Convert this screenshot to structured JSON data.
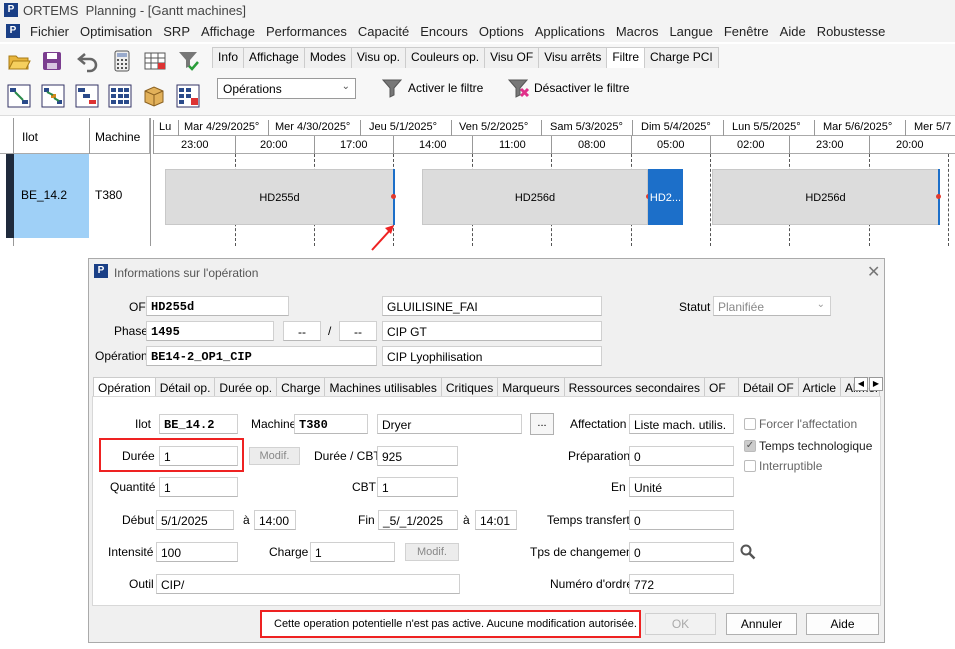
{
  "window": {
    "app_name": "ORTEMS",
    "title": "Planning - [Gantt machines]",
    "logo_letter": "P"
  },
  "menu": [
    "Fichier",
    "Optimisation",
    "SRP",
    "Affichage",
    "Performances",
    "Capacité",
    "Encours",
    "Options",
    "Applications",
    "Macros",
    "Langue",
    "Fenêtre",
    "Aide",
    "Robustesse"
  ],
  "ribbon": {
    "tabs": [
      "Info",
      "Affichage",
      "Modes",
      "Visu op.",
      "Couleurs op.",
      "Visu OF",
      "Visu arrêts",
      "Filtre",
      "Charge PCI"
    ],
    "active_tab": "Filtre",
    "filter_select": "Opérations",
    "activate_filter": "Activer le filtre",
    "deactivate_filter": "Désactiver le filtre"
  },
  "gantt": {
    "col_ilot": "Ilot",
    "col_machine": "Machine",
    "days": [
      "Lu",
      "Mar 4/29/2025°",
      "Mer 4/30/2025°",
      "Jeu 5/1/2025°",
      "Ven 5/2/2025°",
      "Sam 5/3/2025°",
      "Dim 5/4/2025°",
      "Lun 5/5/2025°",
      "Mar 5/6/2025°",
      "Mer 5/7"
    ],
    "times": [
      "23:00",
      "20:00",
      "17:00",
      "14:00",
      "11:00",
      "08:00",
      "05:00",
      "02:00",
      "23:00",
      "20:00"
    ],
    "row": {
      "ilot": "BE_14.2",
      "machine": "T380"
    },
    "bars": [
      "HD255d",
      "HD256d",
      "HD2...",
      "HD256d"
    ]
  },
  "dialog": {
    "title": "Informations sur l'opération",
    "of_label": "OF",
    "of_value": "HD255d",
    "of_desc": "GLUILISINE_FAI",
    "phase_label": "Phase",
    "phase_value": "1495",
    "phase_a": "--",
    "phase_sep": "/",
    "phase_b": "--",
    "phase_desc": "CIP GT",
    "operation_label": "Opération",
    "operation_value": "BE14-2_OP1_CIP",
    "operation_desc": "CIP Lyophilisation",
    "statut_label": "Statut",
    "statut_value": "Planifiée",
    "tabs": [
      "Opération",
      "Détail op.",
      "Durée op.",
      "Charge",
      "Machines utilisables",
      "Critiques",
      "Marqueurs",
      "Ressources secondaires",
      "OF",
      "Détail OF",
      "Article",
      "Alimenta"
    ],
    "active_tab": "Opération",
    "fields": {
      "ilot_label": "Ilot",
      "ilot_value": "BE_14.2",
      "machine_label": "Machine",
      "machine_value": "T380",
      "machine_desc": "Dryer",
      "machine_btn": "...",
      "affectation_label": "Affectation",
      "affectation_value": "Liste mach. utilis.",
      "duree_label": "Durée",
      "duree_value": "1",
      "modif_label": "Modif.",
      "duree_cbt_label": "Durée / CBT",
      "duree_cbt_value": "925",
      "preparation_label": "Préparation",
      "preparation_value": "0",
      "quantite_label": "Quantité",
      "quantite_value": "1",
      "cbt_label": "CBT",
      "cbt_value": "1",
      "en_label": "En",
      "en_value": "Unité",
      "debut_label": "Début",
      "debut_date": "5/1/2025",
      "a_label": "à",
      "debut_time": "14:00",
      "fin_label": "Fin",
      "fin_date": "_5/_1/2025",
      "fin_time": "14:01",
      "temps_transfert_label": "Temps transfert",
      "temps_transfert_value": "0",
      "intensite_label": "Intensité",
      "intensite_value": "100",
      "charge_label": "Charge",
      "charge_value": "1",
      "charge_modif": "Modif.",
      "tps_changement_label": "Tps de changement",
      "tps_changement_value": "0",
      "outil_label": "Outil",
      "outil_value": "CIP/",
      "numero_ordre_label": "Numéro d'ordre",
      "numero_ordre_value": "772"
    },
    "checkboxes": [
      {
        "label": "Forcer l'affectation",
        "checked": false
      },
      {
        "label": "Temps technologique",
        "checked": true
      },
      {
        "label": "Interruptible",
        "checked": false
      }
    ],
    "status_message": "Cette operation potentielle n'est pas active. Aucune modification autorisée.",
    "ok": "OK",
    "cancel": "Annuler",
    "help": "Aide"
  }
}
